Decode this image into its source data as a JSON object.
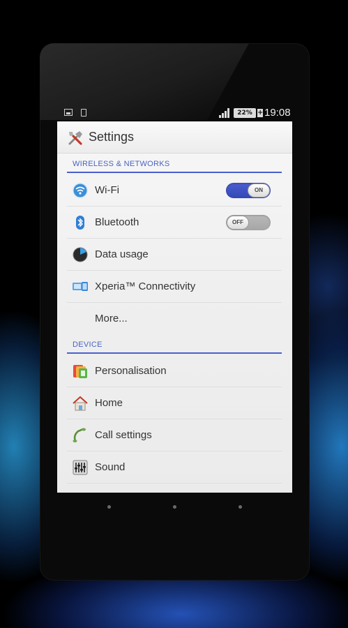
{
  "status_bar": {
    "battery": "22%",
    "charging_plus": "+",
    "time": "19:08"
  },
  "action_bar": {
    "title": "Settings",
    "icon": "settings-tools-icon"
  },
  "sections": [
    {
      "header": "WIRELESS & NETWORKS",
      "items": [
        {
          "label": "Wi-Fi",
          "icon": "wifi-icon",
          "toggle": {
            "state": "on",
            "text": "ON"
          }
        },
        {
          "label": "Bluetooth",
          "icon": "bluetooth-icon",
          "toggle": {
            "state": "off",
            "text": "OFF"
          }
        },
        {
          "label": "Data usage",
          "icon": "data-usage-icon"
        },
        {
          "label": "Xperia™ Connectivity",
          "icon": "xperia-connectivity-icon"
        },
        {
          "label": "More..."
        }
      ]
    },
    {
      "header": "DEVICE",
      "items": [
        {
          "label": "Personalisation",
          "icon": "personalisation-icon"
        },
        {
          "label": "Home",
          "icon": "home-icon"
        },
        {
          "label": "Call settings",
          "icon": "call-settings-icon"
        },
        {
          "label": "Sound",
          "icon": "sound-icon"
        }
      ]
    }
  ],
  "colors": {
    "accent": "#4b5fcf",
    "toggle_on": "#3d51c2",
    "toggle_off": "#b0b0b0",
    "screen_bg": "#efefef"
  }
}
